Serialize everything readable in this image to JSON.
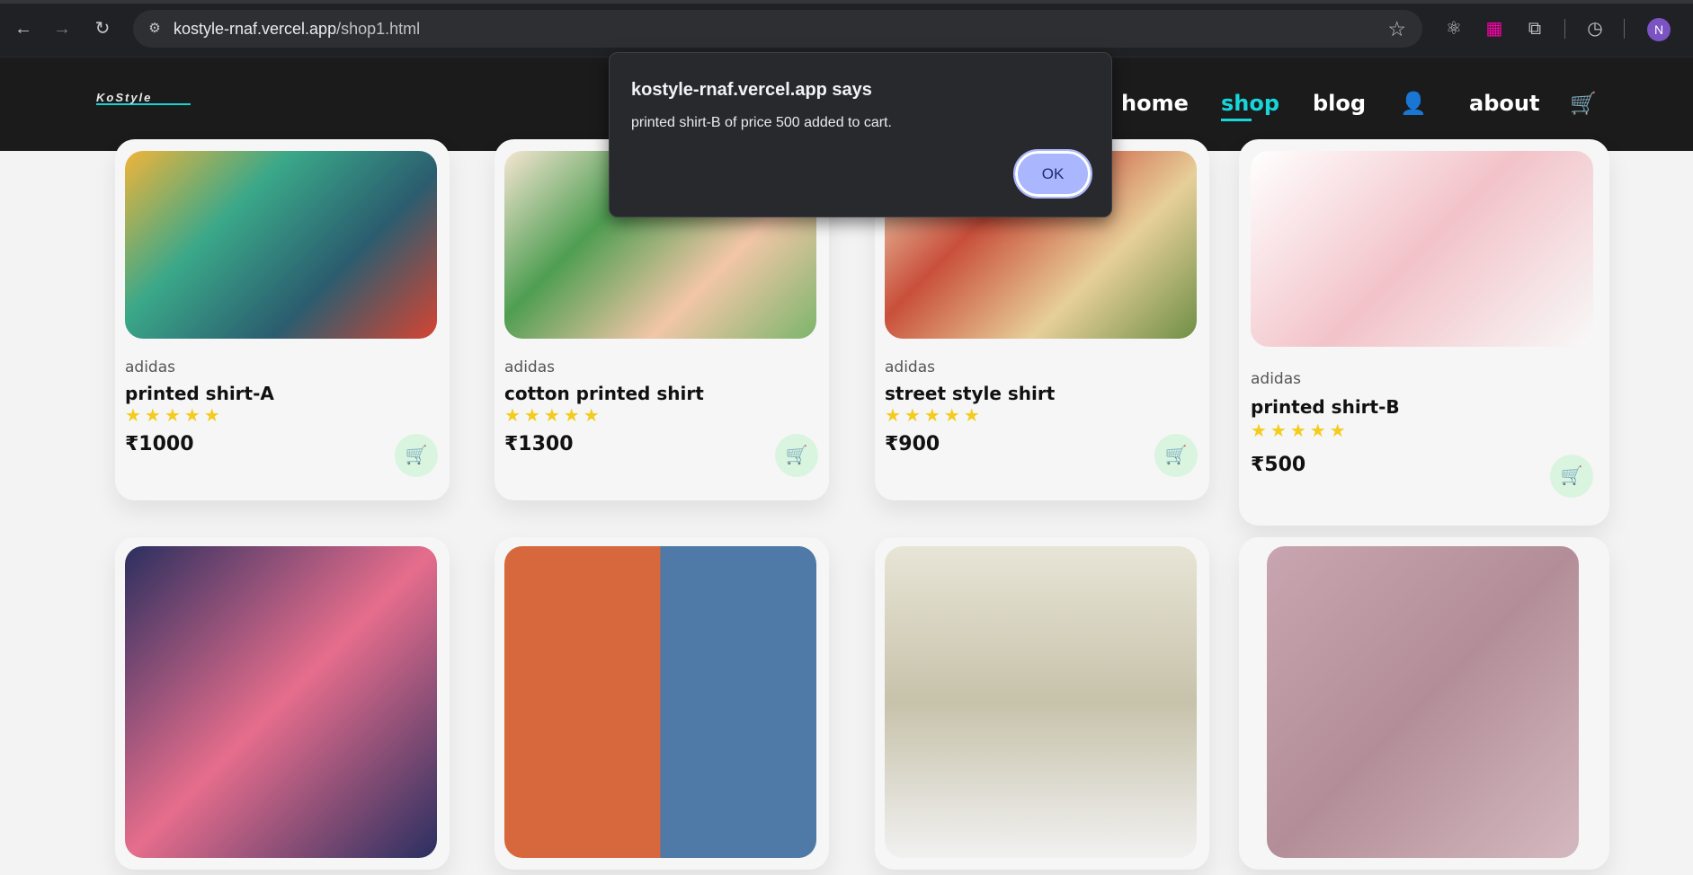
{
  "browser": {
    "url_domain": "kostyle-rnaf.vercel.app",
    "url_path": "/shop1.html"
  },
  "site": {
    "logo": "KoStyle",
    "nav": [
      "home",
      "shop",
      "blog",
      "about"
    ],
    "active_nav": "shop"
  },
  "dialog": {
    "title": "kostyle-rnaf.vercel.app says",
    "message": "printed shirt-B of price 500 added to cart.",
    "ok_label": "OK"
  },
  "products": [
    {
      "brand": "adidas",
      "name": "printed shirt-A",
      "rating": "★★★★★",
      "price": "₹1000"
    },
    {
      "brand": "adidas",
      "name": "cotton printed shirt",
      "rating": "★★★★★",
      "price": "₹1300"
    },
    {
      "brand": "adidas",
      "name": "street style shirt",
      "rating": "★★★★★",
      "price": "₹900"
    },
    {
      "brand": "adidas",
      "name": "printed shirt-B",
      "rating": "★★★★★",
      "price": "₹500"
    }
  ],
  "avatar_initial": "N",
  "colors": {
    "accent": "#17d6da",
    "header": "#1b1b1b",
    "star": "#f3cc1c"
  }
}
